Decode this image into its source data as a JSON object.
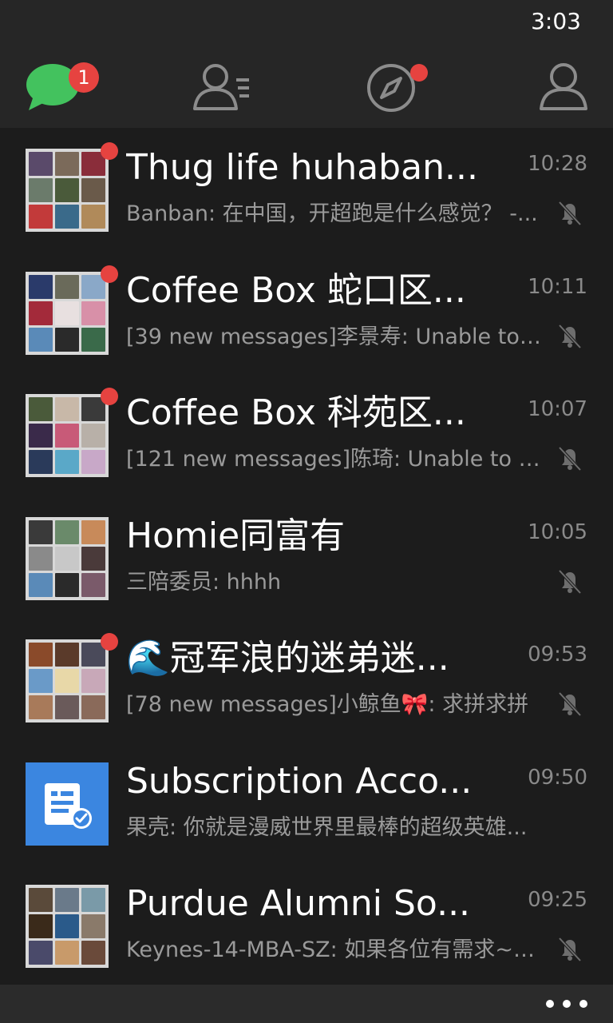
{
  "status_bar": {
    "time": "3:03"
  },
  "nav": {
    "chats_badge": "1",
    "colors": {
      "chats_green": "#43c25e",
      "badge_red": "#e64340",
      "icon_gray": "#8c8c8c"
    },
    "icons": [
      "chat-bubble-icon",
      "contacts-icon",
      "compass-icon",
      "profile-icon"
    ]
  },
  "chats": [
    {
      "title": "Thug life huhaban...",
      "time": "10:28",
      "preview": "Banban: 在中国，开超跑是什么感觉？ -...",
      "unread_dot": true,
      "muted": true
    },
    {
      "title": "Coffee Box 蛇口区...",
      "time": "10:11",
      "preview": "[39 new messages]李景寿: Unable to lo...",
      "unread_dot": true,
      "muted": true
    },
    {
      "title": "Coffee Box 科苑区...",
      "time": "10:07",
      "preview": "[121 new messages]陈琦: Unable to load...",
      "unread_dot": true,
      "muted": true
    },
    {
      "title": "Homie同富有",
      "time": "10:05",
      "preview": "三陪委员: hhhh",
      "unread_dot": false,
      "muted": true
    },
    {
      "title": "🌊冠军浪的迷弟迷...",
      "time": "09:53",
      "preview": "[78 new messages]小鲸鱼🎀: 求拼求拼",
      "unread_dot": true,
      "muted": true
    },
    {
      "title": "Subscription Acco...",
      "time": "09:50",
      "preview": "果壳: 你就是漫威世界里最棒的超级英雄...",
      "unread_dot": false,
      "muted": false,
      "icon": "subscription-icon",
      "avatar_color": "#3b86e0"
    },
    {
      "title": "Purdue Alumni So...",
      "time": "09:25",
      "preview": "Keynes-14-MBA-SZ: 如果各位有需求~~...",
      "unread_dot": false,
      "muted": true
    }
  ],
  "app_bar": {
    "more_icon": "more-ellipsis-icon"
  }
}
